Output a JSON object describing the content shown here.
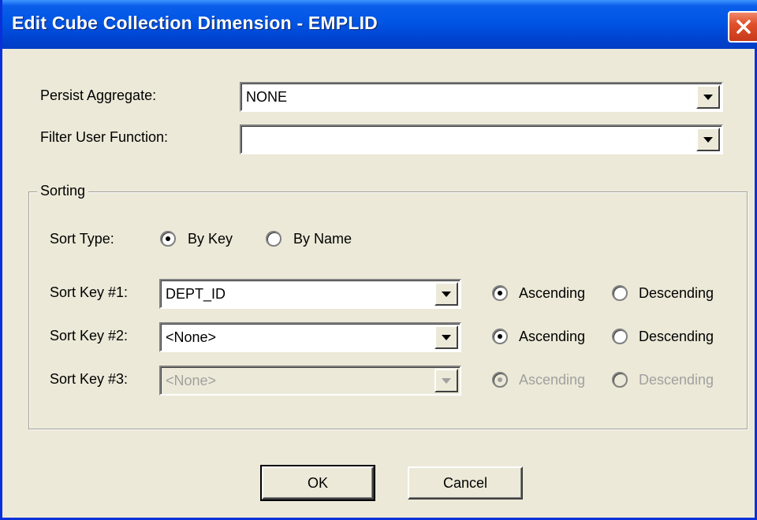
{
  "window": {
    "title": "Edit Cube Collection Dimension - EMPLID"
  },
  "fields": {
    "persist_aggregate_label": "Persist Aggregate:",
    "persist_aggregate_value": "NONE",
    "filter_user_function_label": "Filter User Function:",
    "filter_user_function_value": ""
  },
  "sorting": {
    "group_label": "Sorting",
    "sort_type_label": "Sort Type:",
    "by_key_label": "By Key",
    "by_name_label": "By Name",
    "sort_type_selected": "By Key",
    "keys": [
      {
        "label": "Sort Key #1:",
        "value": "DEPT_ID",
        "order": "Ascending",
        "enabled": true
      },
      {
        "label": "Sort Key #2:",
        "value": "<None>",
        "order": "Ascending",
        "enabled": true
      },
      {
        "label": "Sort Key #3:",
        "value": "<None>",
        "order": "Ascending",
        "enabled": false
      }
    ],
    "ascending_label": "Ascending",
    "descending_label": "Descending"
  },
  "buttons": {
    "ok_label": "OK",
    "cancel_label": "Cancel"
  },
  "colors": {
    "titlebar": "#0055e5",
    "window_bg": "#ece9d8",
    "close_button": "#e0502a"
  }
}
